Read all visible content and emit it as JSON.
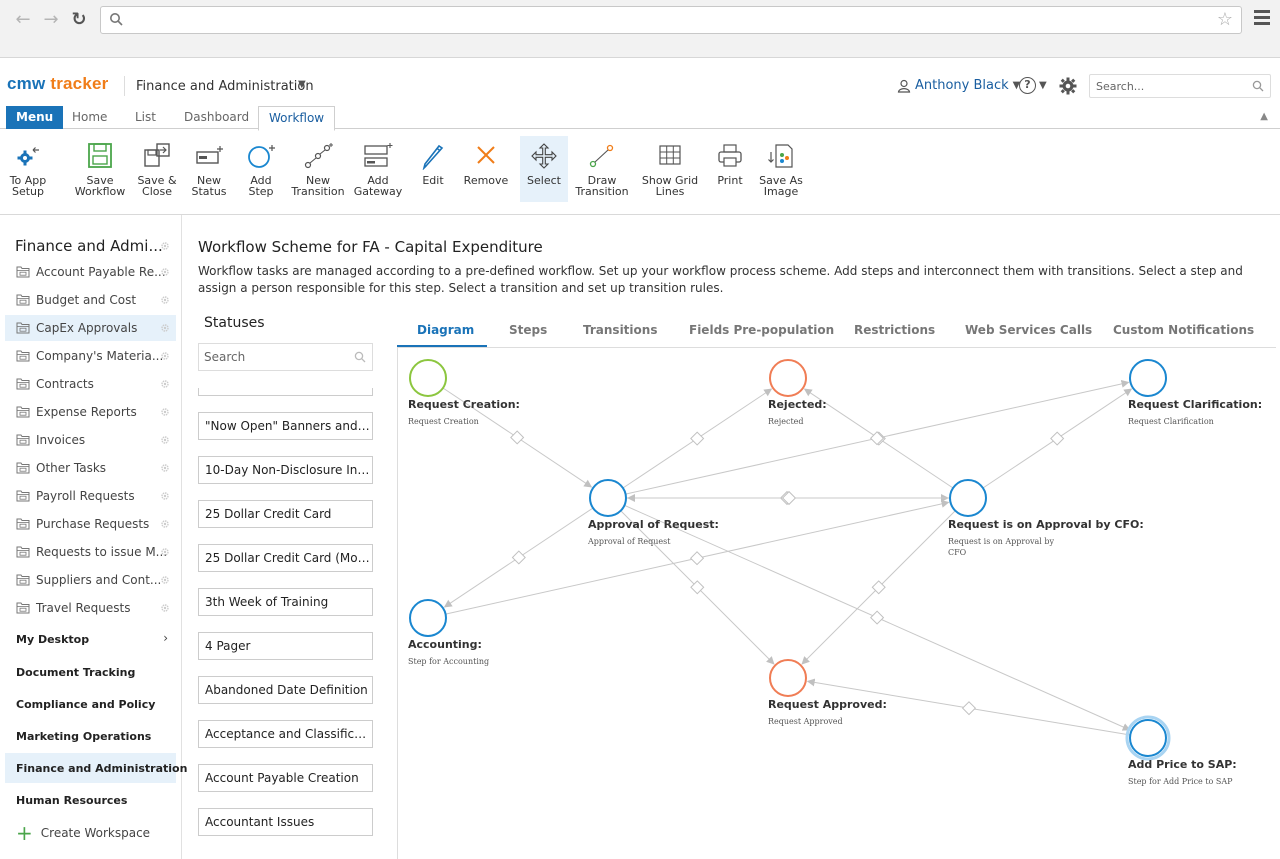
{
  "browser": {
    "colors": {
      "reload": "#555555"
    }
  },
  "app": {
    "logo_part1": "cmw",
    "logo_part2": "tracker",
    "workspace_title": "Finance and Administration",
    "user_name": "Anthony Black",
    "search_placeholder": "Search...",
    "colors": {
      "brand_blue": "#1a73b8",
      "brand_orange": "#f07d19"
    }
  },
  "tabs": {
    "menu": "Menu",
    "home": "Home",
    "list": "List",
    "dashboard": "Dashboard",
    "workflow": "Workflow"
  },
  "ribbon": [
    {
      "id": "to-app-setup",
      "label1": "To App",
      "label2": "Setup",
      "icon": "gear-arrow-icon"
    },
    {
      "id": "save-workflow",
      "label1": "Save",
      "label2": "Workflow",
      "icon": "save-icon"
    },
    {
      "id": "save-close",
      "label1": "Save &",
      "label2": "Close",
      "icon": "save-close-icon"
    },
    {
      "id": "new-status",
      "label1": "New",
      "label2": "Status",
      "icon": "new-status-icon"
    },
    {
      "id": "add-step",
      "label1": "Add",
      "label2": "Step",
      "icon": "add-step-icon"
    },
    {
      "id": "new-transition",
      "label1": "New",
      "label2": "Transition",
      "icon": "new-transition-icon"
    },
    {
      "id": "add-gateway",
      "label1": "Add",
      "label2": "Gateway",
      "icon": "add-gateway-icon"
    },
    {
      "id": "edit",
      "label1": "Edit",
      "label2": "",
      "icon": "pencil-icon"
    },
    {
      "id": "remove",
      "label1": "Remove",
      "label2": "",
      "icon": "remove-icon"
    },
    {
      "id": "select",
      "label1": "Select",
      "label2": "",
      "icon": "move-icon"
    },
    {
      "id": "draw-transition",
      "label1": "Draw",
      "label2": "Transition",
      "icon": "draw-transition-icon"
    },
    {
      "id": "show-grid-lines",
      "label1": "Show Grid",
      "label2": "Lines",
      "icon": "grid-icon"
    },
    {
      "id": "print",
      "label1": "Print",
      "label2": "",
      "icon": "printer-icon"
    },
    {
      "id": "save-as-image",
      "label1": "Save As",
      "label2": "Image",
      "icon": "save-image-icon"
    }
  ],
  "sidebar": {
    "title": "Finance and Admi...",
    "items": [
      {
        "label": "Account Payable Re..."
      },
      {
        "label": "Budget and Cost"
      },
      {
        "label": "CapEx Approvals"
      },
      {
        "label": "Company's Materia..."
      },
      {
        "label": "Contracts"
      },
      {
        "label": "Expense Reports"
      },
      {
        "label": "Invoices"
      },
      {
        "label": "Other Tasks"
      },
      {
        "label": "Payroll Requests"
      },
      {
        "label": "Purchase Requests"
      },
      {
        "label": "Requests to issue M..."
      },
      {
        "label": "Suppliers and Cont..."
      },
      {
        "label": "Travel Requests"
      }
    ],
    "sections": [
      {
        "label": "My Desktop",
        "chevron": "›"
      },
      {
        "label": "Document Tracking"
      },
      {
        "label": "Compliance and Policy"
      },
      {
        "label": "Marketing Operations"
      },
      {
        "label": "Finance and Administration"
      },
      {
        "label": "Human Resources"
      }
    ],
    "create_workspace": "Create Workspace"
  },
  "main": {
    "title": "Workflow Scheme for FA - Capital Expenditure",
    "description": "Workflow tasks are managed according to a pre-defined workflow. Set up your workflow process scheme. Add steps and interconnect them with transitions. Select a step and assign a person responsible for this step. Select a transition and set up transition rules."
  },
  "statuses": {
    "title": "Statuses",
    "search_placeholder": "Search",
    "items": [
      "\"Now Open\" Banners and/o...",
      "10-Day Non-Disclosure Initi...",
      "25 Dollar Credit Card",
      "25 Dollar Credit Card (Mock...",
      "3th Week of Training",
      "4 Pager",
      "Abandoned Date Definition",
      "Acceptance and Classificati...",
      "Account Payable Creation",
      "Accountant Issues"
    ]
  },
  "diagram_tabs": [
    "Diagram",
    "Steps",
    "Transitions",
    "Fields Pre-population",
    "Restrictions",
    "Web Services Calls",
    "Custom Notifications"
  ],
  "diagram": {
    "colors": {
      "start": "#8cc63f",
      "step": "#1a87d0",
      "end": "#f07d55",
      "line": "#c8c8c8"
    },
    "nodes": [
      {
        "id": "request-creation",
        "title": "Request Creation:",
        "subtitle": "Request Creation",
        "kind": "start"
      },
      {
        "id": "rejected",
        "title": "Rejected:",
        "subtitle": "Rejected",
        "kind": "end"
      },
      {
        "id": "request-clarification",
        "title": "Request Clarification:",
        "subtitle": "Request Clarification",
        "kind": "step"
      },
      {
        "id": "approval-of-request",
        "title": "Approval of Request:",
        "subtitle": "Approval of Request",
        "kind": "step"
      },
      {
        "id": "approval-by-cfo",
        "title": "Request is on Approval by CFO:",
        "subtitle_line1": "Request is on Approval by",
        "subtitle_line2": "CFO",
        "kind": "step"
      },
      {
        "id": "accounting",
        "title": "Accounting:",
        "subtitle": "Step for Accounting",
        "kind": "step"
      },
      {
        "id": "request-approved",
        "title": "Request Approved:",
        "subtitle": "Request Approved",
        "kind": "end"
      },
      {
        "id": "add-price-to-sap",
        "title": "Add Price to SAP:",
        "subtitle": "Step for Add Price to SAP",
        "kind": "step"
      }
    ]
  }
}
